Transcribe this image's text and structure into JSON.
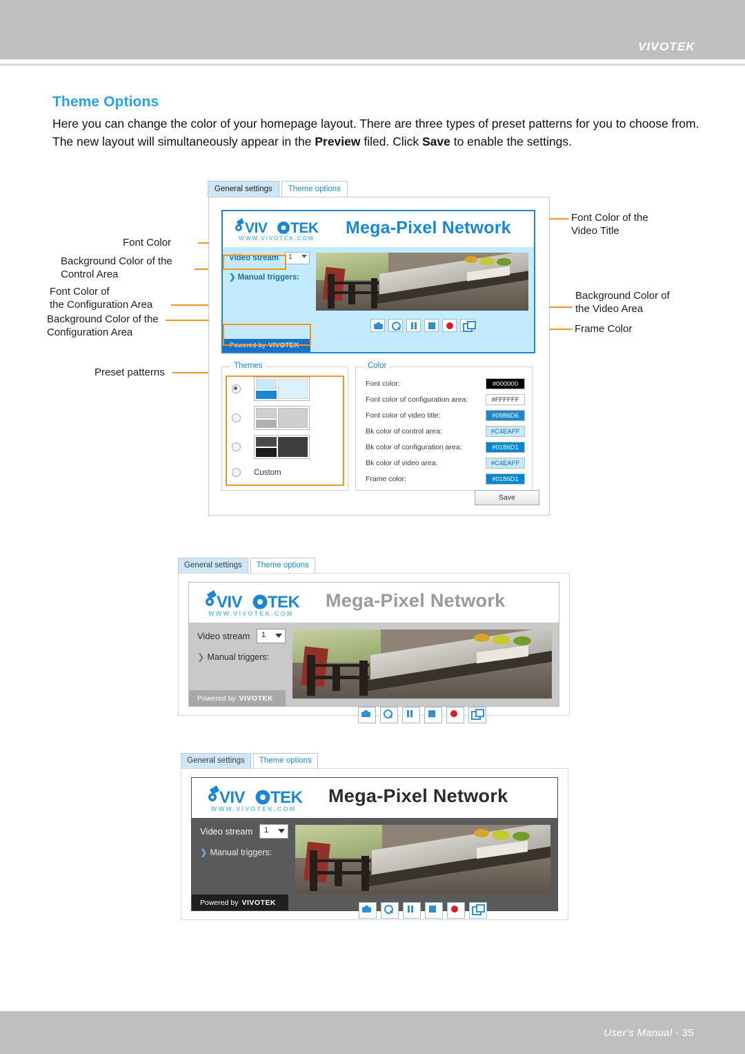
{
  "header": {
    "brand": "VIVOTEK"
  },
  "footer": {
    "label": "User's Manual",
    "sep": "-",
    "page": "35"
  },
  "section": {
    "title": "Theme Options",
    "paragraph_1": "Here you can change the color of your homepage layout. There are three types of preset patterns for you to choose from. The new layout will simultaneously appear in the ",
    "bold_preview": "Preview",
    "paragraph_2": " filed. Click ",
    "bold_save": "Save",
    "paragraph_3": " to enable the settings."
  },
  "dialog": {
    "tabs": [
      {
        "label": "General settings",
        "active": true
      },
      {
        "label": "Theme options",
        "active": false
      }
    ],
    "camera": {
      "brand": "VIVOTEK",
      "brand_url": "WWW.VIVOTEK.COM",
      "title": "Mega-Pixel Network",
      "video_stream_label": "Video stream",
      "video_stream_value": "1",
      "manual_triggers_label": "Manual triggers:",
      "manual_triggers_chevron": "❯",
      "powered_by": "Powered by",
      "powered_brand": "VIVOTEK",
      "controls": [
        {
          "name": "snapshot",
          "glyph": "camera"
        },
        {
          "name": "digital-zoom",
          "glyph": "magnifier"
        },
        {
          "name": "pause",
          "glyph": "pause"
        },
        {
          "name": "stop",
          "glyph": "stop"
        },
        {
          "name": "record",
          "glyph": "record"
        },
        {
          "name": "fullscreen",
          "glyph": "expand"
        }
      ]
    },
    "themes": {
      "legend": "Themes",
      "options": [
        {
          "id": "theme-blue",
          "selected": true,
          "label": ""
        },
        {
          "id": "theme-gray",
          "selected": false,
          "label": ""
        },
        {
          "id": "theme-dark",
          "selected": false,
          "label": ""
        },
        {
          "id": "theme-custom",
          "selected": false,
          "label": "Custom"
        }
      ]
    },
    "color": {
      "legend": "Color",
      "rows": [
        {
          "label": "Font color:",
          "value": "#000000",
          "bg": "#000000",
          "fg": "#ffffff"
        },
        {
          "label": "Font color of configuration area:",
          "value": "#FFFFFF",
          "bg": "#ffffff",
          "fg": "#333333"
        },
        {
          "label": "Font color of video title:",
          "value": "#0986D6",
          "bg": "#1b86d1",
          "fg": "#ffffff"
        },
        {
          "label": "Bk color of control area:",
          "value": "#C4EAFF",
          "bg": "#c4eaff",
          "fg": "#2b5f80"
        },
        {
          "label": "Bk color of configuration area:",
          "value": "#0186D1",
          "bg": "#0186d1",
          "fg": "#ffffff"
        },
        {
          "label": "Bk color of video area:",
          "value": "#C4EAFF",
          "bg": "#c4eaff",
          "fg": "#2b5f80"
        },
        {
          "label": "Frame color:",
          "value": "#0186D1",
          "bg": "#0186d1",
          "fg": "#ffffff"
        }
      ]
    },
    "save_label": "Save"
  },
  "callouts": {
    "font_color": "Font Color",
    "bk_control_area": "Background Color of the\nControl Area",
    "font_config_area": "Font Color of\nthe Configuration Area",
    "bk_config_area": "Background Color of the\nConfiguration Area",
    "preset_patterns": "Preset patterns",
    "font_video_title": "Font Color of the\nVideo Title",
    "bk_video_area": "Background Color of\nthe Video Area",
    "frame_color": "Frame Color"
  },
  "previews": [
    {
      "id": "preview-gray",
      "tabs": [
        {
          "label": "General settings",
          "active": true
        },
        {
          "label": "Theme options",
          "active": false
        }
      ],
      "title": "Mega-Pixel Network",
      "title_color": "#9a9a9a",
      "video_stream_label": "Video stream",
      "video_stream_value": "1",
      "manual_triggers_label": "Manual triggers:",
      "manual_triggers_chevron": "❯",
      "powered_by": "Powered by",
      "powered_brand": "VIVOTEK",
      "brand": "VIVOTEK",
      "brand_url": "WWW.VIVOTEK.COM",
      "control_bg": "#c9c9c9",
      "config_bg": "#a8a8a8",
      "video_bg": "#c9c9c9",
      "frame_color": "#bdbdbd",
      "font_color": "#2b2b2b",
      "config_font": "#ffffff"
    },
    {
      "id": "preview-dark",
      "tabs": [
        {
          "label": "General settings",
          "active": true
        },
        {
          "label": "Theme options",
          "active": false
        }
      ],
      "title": "Mega-Pixel Network",
      "title_color": "#2b2b2b",
      "video_stream_label": "Video stream",
      "video_stream_value": "1",
      "manual_triggers_label": "Manual triggers:",
      "manual_triggers_chevron": "❯",
      "powered_by": "Powered by",
      "powered_brand": "VIVOTEK",
      "brand": "VIVOTEK",
      "brand_url": "WWW.VIVOTEK.COM",
      "control_bg": "#5a5a5a",
      "config_bg": "#2b2b2b",
      "video_bg": "#5a5a5a",
      "frame_color": "#4a4a4a",
      "font_color": "#f2f2f2",
      "config_font": "#ffffff"
    }
  ]
}
